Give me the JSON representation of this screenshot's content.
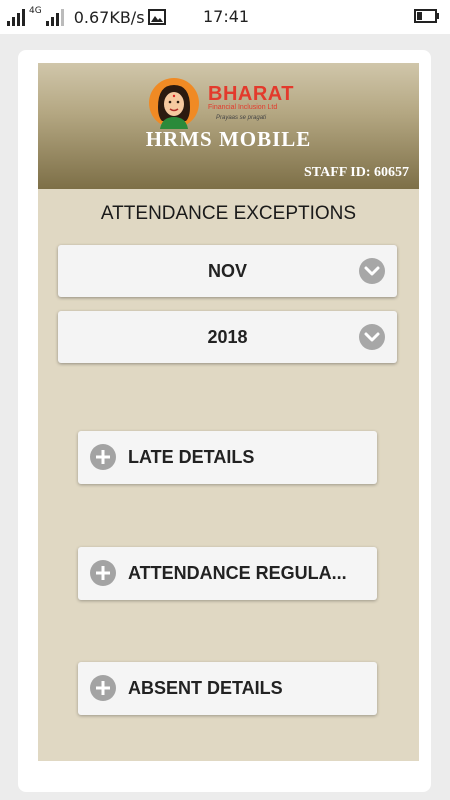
{
  "status_bar": {
    "network": "4G",
    "speed": "0.67KB/s",
    "time": "17:41"
  },
  "header": {
    "logo_brand": "BHARAT",
    "logo_subtitle": "Financial Inclusion Ltd",
    "logo_tagline": "Prayaas se pragati",
    "app_title": "HRMS MOBILE",
    "staff_id": "STAFF ID: 60657"
  },
  "page_title": "ATTENDANCE EXCEPTIONS",
  "month_select": {
    "value": "NOV"
  },
  "year_select": {
    "value": "2018"
  },
  "actions": [
    {
      "label": "LATE DETAILS",
      "icon": "plus-circle-icon"
    },
    {
      "label": "ATTENDANCE REGULA...",
      "icon": "plus-circle-icon"
    },
    {
      "label": "ABSENT DETAILS",
      "icon": "plus-circle-icon"
    }
  ],
  "colors": {
    "panel_bg": "#e0d8c3",
    "header_top": "#d0c6aa",
    "header_bottom": "#7d6f47",
    "brand_red": "#e33a2c",
    "icon_gray": "#a3a3a3"
  }
}
